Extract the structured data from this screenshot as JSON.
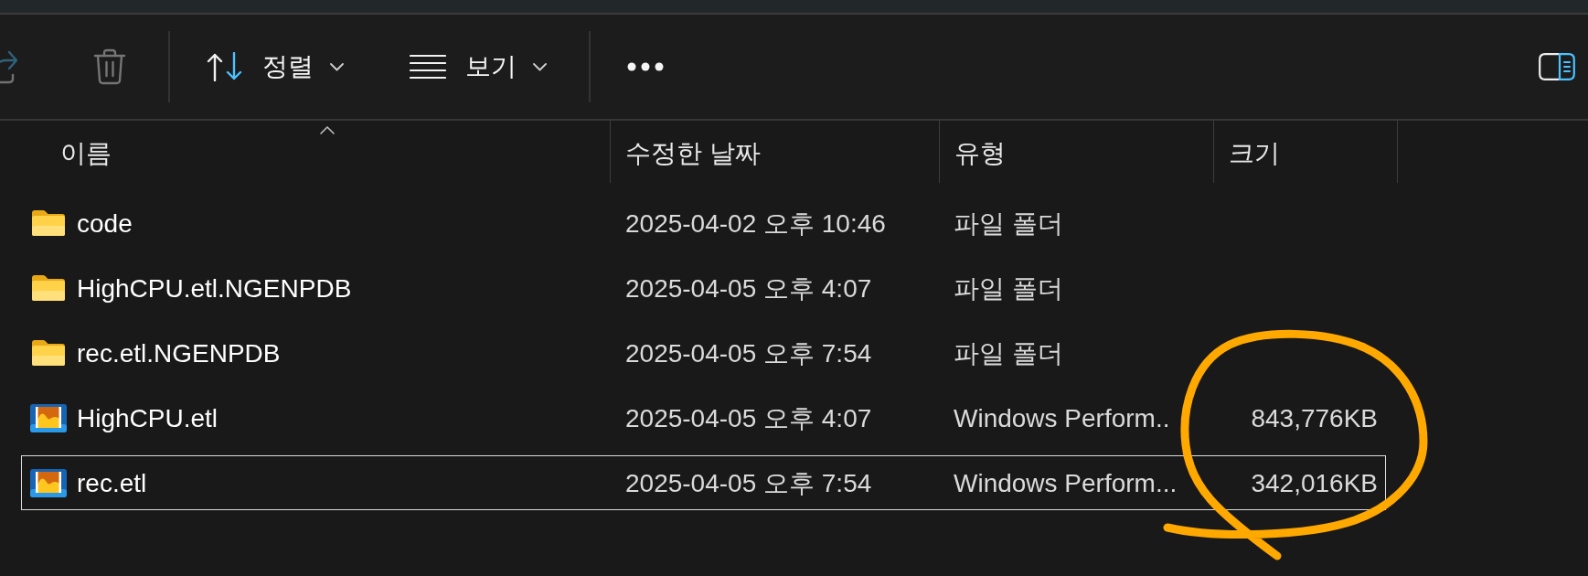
{
  "toolbar": {
    "groups": [
      [
        {
          "kind": "share",
          "disabled": true,
          "dropdown": false
        },
        {
          "kind": "delete",
          "disabled": true,
          "dropdown": false
        }
      ],
      [
        {
          "kind": "sort",
          "label": "정렬",
          "disabled": false,
          "dropdown": true
        },
        {
          "kind": "view",
          "label": "보기",
          "disabled": false,
          "dropdown": true
        }
      ],
      [
        {
          "kind": "more",
          "disabled": false,
          "dropdown": false
        }
      ]
    ],
    "end": [
      {
        "kind": "details_pane",
        "disabled": false,
        "dropdown": false
      }
    ]
  },
  "table": {
    "columns": [
      {
        "label": "이름",
        "sorted": true
      },
      {
        "label": "수정한 날짜",
        "sorted": false
      },
      {
        "label": "유형",
        "sorted": false
      },
      {
        "label": "크기",
        "sorted": false
      }
    ],
    "rows": [
      {
        "kind": "folder",
        "name": "code",
        "modified": "2025-04-02 오후 10:46",
        "type": "파일 폴더",
        "focused": false
      },
      {
        "kind": "folder",
        "name": "HighCPU.etl.NGENPDB",
        "modified": "2025-04-05 오후 4:07",
        "type": "파일 폴더",
        "focused": false
      },
      {
        "kind": "folder",
        "name": "rec.etl.NGENPDB",
        "modified": "2025-04-05 오후 7:54",
        "type": "파일 폴더",
        "focused": false
      },
      {
        "kind": "trace",
        "name": "HighCPU.etl",
        "modified": "2025-04-05 오후 4:07",
        "type": "Windows Perform..",
        "size": "843,776KB",
        "focused": false
      },
      {
        "kind": "trace",
        "name": "rec.etl",
        "modified": "2025-04-05 오후 7:54",
        "type": "Windows Perform...",
        "size": "342,016KB",
        "focused": true
      }
    ]
  },
  "annotation": {
    "kind": "loop"
  }
}
